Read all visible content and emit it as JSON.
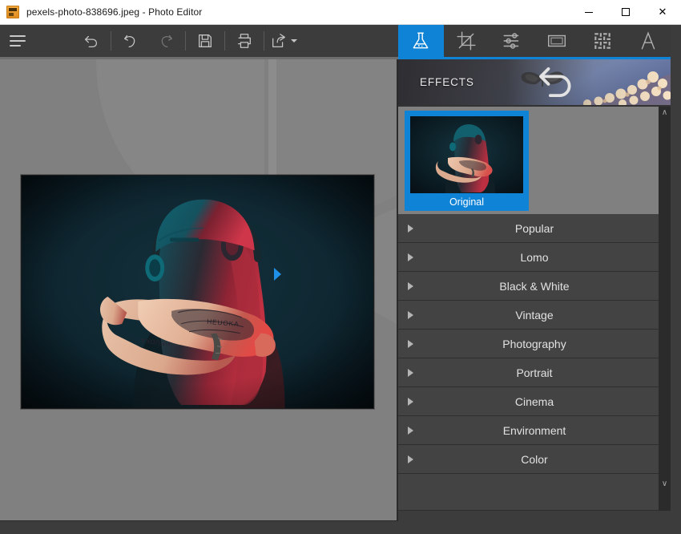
{
  "window": {
    "title": "pexels-photo-838696.jpeg - Photo Editor",
    "app_icon": "photo-app-icon",
    "minimize_label": "Minimize",
    "maximize_label": "Maximize",
    "close_label": "Close",
    "close_glyph": "✕"
  },
  "toolbar": {
    "menu_label": "Menu",
    "items": [
      {
        "name": "menu-button",
        "icon": "hamburger-icon",
        "label": "Menu",
        "enabled": true
      },
      {
        "name": "revert-button",
        "icon": "revert-icon",
        "label": "Revert",
        "enabled": true
      },
      {
        "name": "undo-button",
        "icon": "undo-icon",
        "label": "Undo",
        "enabled": true
      },
      {
        "name": "redo-button",
        "icon": "redo-icon",
        "label": "Redo",
        "enabled": false
      },
      {
        "name": "save-button",
        "icon": "save-icon",
        "label": "Save",
        "enabled": true
      },
      {
        "name": "print-button",
        "icon": "print-icon",
        "label": "Print",
        "enabled": true
      },
      {
        "name": "share-button",
        "icon": "share-icon",
        "label": "Share",
        "enabled": true
      }
    ]
  },
  "canvas": {
    "photo_name": "pexels-photo-838696.jpeg",
    "watermark": "app-logo-watermark",
    "background_color": "#808080"
  },
  "panel": {
    "accent_color": "#0f83d6",
    "tabs": [
      {
        "name": "tab-effects",
        "icon": "flask-icon",
        "label": "Effects",
        "active": true
      },
      {
        "name": "tab-crop",
        "icon": "crop-icon",
        "label": "Crop",
        "active": false
      },
      {
        "name": "tab-adjust",
        "icon": "sliders-icon",
        "label": "Adjust",
        "active": false
      },
      {
        "name": "tab-frame",
        "icon": "frame-icon",
        "label": "Frame",
        "active": false
      },
      {
        "name": "tab-texture",
        "icon": "texture-icon",
        "label": "Texture",
        "active": false
      },
      {
        "name": "tab-text",
        "icon": "text-a-icon",
        "label": "Text",
        "active": false
      }
    ],
    "banner": {
      "title": "EFFECTS",
      "reset_icon": "reset-arrow-icon",
      "image": "butterfly-blossom-banner"
    },
    "thumbnails": [
      {
        "name": "effect-thumb-original",
        "label": "Original",
        "selected": true
      }
    ],
    "scrollbar": {
      "up_glyph": "∧",
      "down_glyph": "∨"
    },
    "categories": [
      {
        "name": "category-popular",
        "label": "Popular",
        "expanded": false
      },
      {
        "name": "category-lomo",
        "label": "Lomo",
        "expanded": false
      },
      {
        "name": "category-black-and-white",
        "label": "Black & White",
        "expanded": false
      },
      {
        "name": "category-vintage",
        "label": "Vintage",
        "expanded": false
      },
      {
        "name": "category-photography",
        "label": "Photography",
        "expanded": false
      },
      {
        "name": "category-portrait",
        "label": "Portrait",
        "expanded": false
      },
      {
        "name": "category-cinema",
        "label": "Cinema",
        "expanded": false
      },
      {
        "name": "category-environment",
        "label": "Environment",
        "expanded": false
      },
      {
        "name": "category-color",
        "label": "Color",
        "expanded": false
      }
    ],
    "collapse_handle": "panel-collapse-handle"
  }
}
